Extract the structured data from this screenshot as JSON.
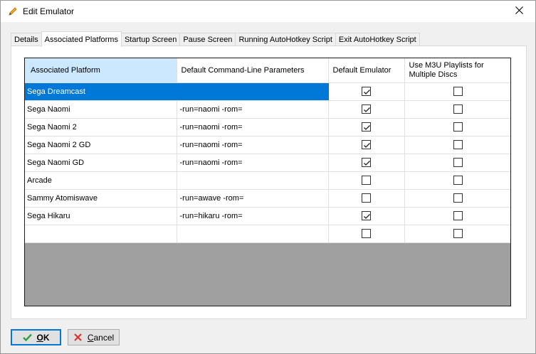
{
  "window": {
    "title": "Edit Emulator"
  },
  "tabs": [
    {
      "label": "Details",
      "active": false
    },
    {
      "label": "Associated Platforms",
      "active": true
    },
    {
      "label": "Startup Screen",
      "active": false
    },
    {
      "label": "Pause Screen",
      "active": false
    },
    {
      "label": "Running AutoHotkey Script",
      "active": false
    },
    {
      "label": "Exit AutoHotkey Script",
      "active": false
    }
  ],
  "grid": {
    "columns": [
      "Associated Platform",
      "Default Command-Line Parameters",
      "Default Emulator",
      "Use M3U Playlists for Multiple Discs"
    ],
    "rows": [
      {
        "platform": "Sega Dreamcast",
        "params": "",
        "default_emulator": true,
        "m3u": false,
        "selected": true
      },
      {
        "platform": "Sega Naomi",
        "params": "-run=naomi -rom=",
        "default_emulator": true,
        "m3u": false
      },
      {
        "platform": "Sega Naomi 2",
        "params": "-run=naomi -rom=",
        "default_emulator": true,
        "m3u": false
      },
      {
        "platform": "Sega Naomi 2 GD",
        "params": "-run=naomi -rom=",
        "default_emulator": true,
        "m3u": false
      },
      {
        "platform": "Sega Naomi GD",
        "params": "-run=naomi -rom=",
        "default_emulator": true,
        "m3u": false
      },
      {
        "platform": "Arcade",
        "params": "",
        "default_emulator": false,
        "m3u": false
      },
      {
        "platform": "Sammy Atomiswave",
        "params": "-run=awave -rom=",
        "default_emulator": false,
        "m3u": false
      },
      {
        "platform": "Sega Hikaru",
        "params": "-run=hikaru -rom=",
        "default_emulator": true,
        "m3u": false
      },
      {
        "platform": "",
        "params": "",
        "default_emulator": false,
        "m3u": false
      }
    ]
  },
  "buttons": {
    "ok_label": "OK",
    "cancel_label": "Cancel"
  },
  "colors": {
    "selection": "#0078d7",
    "header_active": "#cce8ff",
    "empty_grid_area": "#a0a0a0",
    "ok_check": "#2ea043",
    "cancel_x": "#d9342b"
  }
}
